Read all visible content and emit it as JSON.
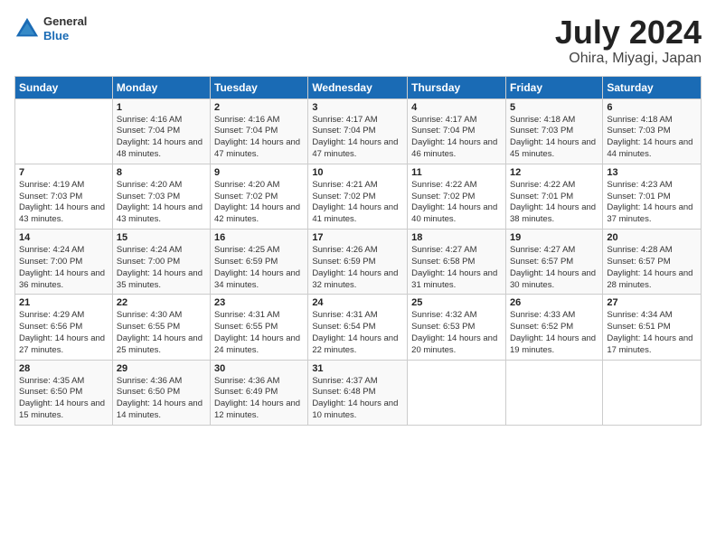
{
  "header": {
    "logo": {
      "line1": "General",
      "line2": "Blue"
    },
    "title": "July 2024",
    "location": "Ohira, Miyagi, Japan"
  },
  "calendar": {
    "days_of_week": [
      "Sunday",
      "Monday",
      "Tuesday",
      "Wednesday",
      "Thursday",
      "Friday",
      "Saturday"
    ],
    "weeks": [
      [
        {
          "day": "",
          "info": ""
        },
        {
          "day": "1",
          "info": "Sunrise: 4:16 AM\nSunset: 7:04 PM\nDaylight: 14 hours\nand 48 minutes."
        },
        {
          "day": "2",
          "info": "Sunrise: 4:16 AM\nSunset: 7:04 PM\nDaylight: 14 hours\nand 47 minutes."
        },
        {
          "day": "3",
          "info": "Sunrise: 4:17 AM\nSunset: 7:04 PM\nDaylight: 14 hours\nand 47 minutes."
        },
        {
          "day": "4",
          "info": "Sunrise: 4:17 AM\nSunset: 7:04 PM\nDaylight: 14 hours\nand 46 minutes."
        },
        {
          "day": "5",
          "info": "Sunrise: 4:18 AM\nSunset: 7:03 PM\nDaylight: 14 hours\nand 45 minutes."
        },
        {
          "day": "6",
          "info": "Sunrise: 4:18 AM\nSunset: 7:03 PM\nDaylight: 14 hours\nand 44 minutes."
        }
      ],
      [
        {
          "day": "7",
          "info": "Sunrise: 4:19 AM\nSunset: 7:03 PM\nDaylight: 14 hours\nand 43 minutes."
        },
        {
          "day": "8",
          "info": "Sunrise: 4:20 AM\nSunset: 7:03 PM\nDaylight: 14 hours\nand 43 minutes."
        },
        {
          "day": "9",
          "info": "Sunrise: 4:20 AM\nSunset: 7:02 PM\nDaylight: 14 hours\nand 42 minutes."
        },
        {
          "day": "10",
          "info": "Sunrise: 4:21 AM\nSunset: 7:02 PM\nDaylight: 14 hours\nand 41 minutes."
        },
        {
          "day": "11",
          "info": "Sunrise: 4:22 AM\nSunset: 7:02 PM\nDaylight: 14 hours\nand 40 minutes."
        },
        {
          "day": "12",
          "info": "Sunrise: 4:22 AM\nSunset: 7:01 PM\nDaylight: 14 hours\nand 38 minutes."
        },
        {
          "day": "13",
          "info": "Sunrise: 4:23 AM\nSunset: 7:01 PM\nDaylight: 14 hours\nand 37 minutes."
        }
      ],
      [
        {
          "day": "14",
          "info": "Sunrise: 4:24 AM\nSunset: 7:00 PM\nDaylight: 14 hours\nand 36 minutes."
        },
        {
          "day": "15",
          "info": "Sunrise: 4:24 AM\nSunset: 7:00 PM\nDaylight: 14 hours\nand 35 minutes."
        },
        {
          "day": "16",
          "info": "Sunrise: 4:25 AM\nSunset: 6:59 PM\nDaylight: 14 hours\nand 34 minutes."
        },
        {
          "day": "17",
          "info": "Sunrise: 4:26 AM\nSunset: 6:59 PM\nDaylight: 14 hours\nand 32 minutes."
        },
        {
          "day": "18",
          "info": "Sunrise: 4:27 AM\nSunset: 6:58 PM\nDaylight: 14 hours\nand 31 minutes."
        },
        {
          "day": "19",
          "info": "Sunrise: 4:27 AM\nSunset: 6:57 PM\nDaylight: 14 hours\nand 30 minutes."
        },
        {
          "day": "20",
          "info": "Sunrise: 4:28 AM\nSunset: 6:57 PM\nDaylight: 14 hours\nand 28 minutes."
        }
      ],
      [
        {
          "day": "21",
          "info": "Sunrise: 4:29 AM\nSunset: 6:56 PM\nDaylight: 14 hours\nand 27 minutes."
        },
        {
          "day": "22",
          "info": "Sunrise: 4:30 AM\nSunset: 6:55 PM\nDaylight: 14 hours\nand 25 minutes."
        },
        {
          "day": "23",
          "info": "Sunrise: 4:31 AM\nSunset: 6:55 PM\nDaylight: 14 hours\nand 24 minutes."
        },
        {
          "day": "24",
          "info": "Sunrise: 4:31 AM\nSunset: 6:54 PM\nDaylight: 14 hours\nand 22 minutes."
        },
        {
          "day": "25",
          "info": "Sunrise: 4:32 AM\nSunset: 6:53 PM\nDaylight: 14 hours\nand 20 minutes."
        },
        {
          "day": "26",
          "info": "Sunrise: 4:33 AM\nSunset: 6:52 PM\nDaylight: 14 hours\nand 19 minutes."
        },
        {
          "day": "27",
          "info": "Sunrise: 4:34 AM\nSunset: 6:51 PM\nDaylight: 14 hours\nand 17 minutes."
        }
      ],
      [
        {
          "day": "28",
          "info": "Sunrise: 4:35 AM\nSunset: 6:50 PM\nDaylight: 14 hours\nand 15 minutes."
        },
        {
          "day": "29",
          "info": "Sunrise: 4:36 AM\nSunset: 6:50 PM\nDaylight: 14 hours\nand 14 minutes."
        },
        {
          "day": "30",
          "info": "Sunrise: 4:36 AM\nSunset: 6:49 PM\nDaylight: 14 hours\nand 12 minutes."
        },
        {
          "day": "31",
          "info": "Sunrise: 4:37 AM\nSunset: 6:48 PM\nDaylight: 14 hours\nand 10 minutes."
        },
        {
          "day": "",
          "info": ""
        },
        {
          "day": "",
          "info": ""
        },
        {
          "day": "",
          "info": ""
        }
      ]
    ]
  }
}
